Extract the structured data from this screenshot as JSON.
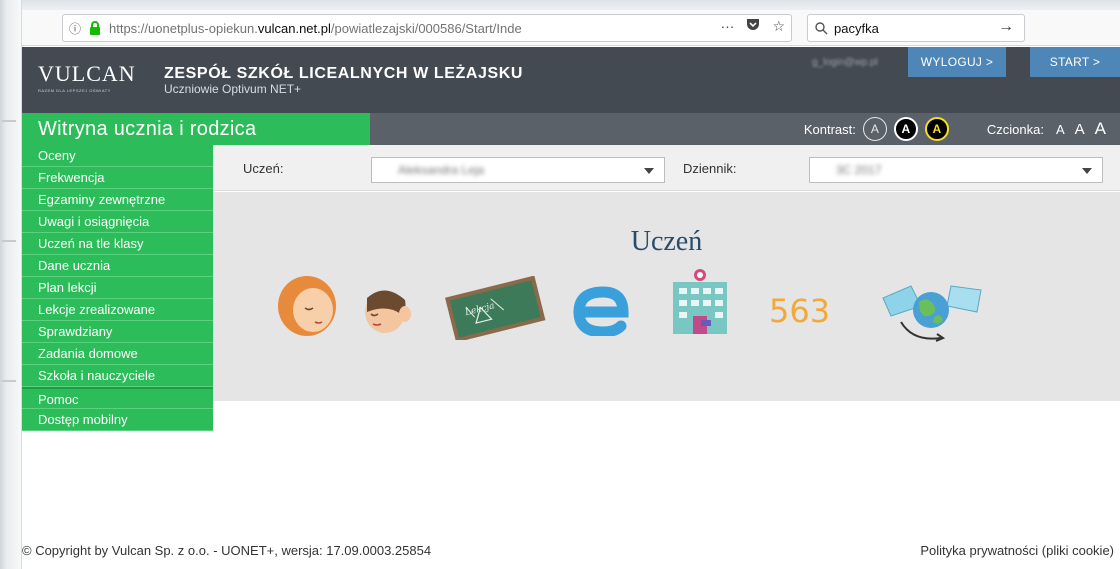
{
  "browser": {
    "url_prefix": "https://uonetplus-opiekun.",
    "url_domain": "vulcan.net.pl",
    "url_suffix": "/powiatlezajski/000586/Start/Inde",
    "more_icon": "···",
    "search_value": "pacyfka"
  },
  "header": {
    "logo_word": "VULCAN",
    "logo_tagline": "RAZEM DLA LEPSZEJ OŚWIATY",
    "school_name": "ZESPÓŁ SZKÓŁ LICEALNYCH W LEŻAJSKU",
    "school_subtitle": "Uczniowie Optivum NET+",
    "user_email": "g_login@wp.pl",
    "logout_label": "WYLOGUJ >",
    "start_label": "START >"
  },
  "band": {
    "title": "Witryna ucznia i rodzica",
    "contrast_label": "Kontrast:",
    "contrast_options": [
      "A",
      "A",
      "A"
    ],
    "font_label": "Czcionka:",
    "font_sizes": [
      "A",
      "A",
      "A"
    ]
  },
  "sidebar": {
    "items": [
      "Oceny",
      "Frekwencja",
      "Egzaminy zewnętrzne",
      "Uwagi i osiągnięcia",
      "Uczeń na tle klasy",
      "Dane ucznia",
      "Plan lekcji",
      "Lekcje zrealizowane",
      "Sprawdziany",
      "Zadania domowe",
      "Szkoła i nauczyciele",
      "Pomoc",
      "Dostęp mobilny"
    ]
  },
  "filters": {
    "student_label": "Uczeń:",
    "student_value": "Aleksandra Leja",
    "journal_label": "Dziennik:",
    "journal_value": "3C 2017"
  },
  "hero": {
    "title": "Uczeń",
    "icons": [
      "people-talking-icon",
      "chalkboard-icon",
      "e-letter-icon",
      "school-building-icon",
      "numbers-563-icon",
      "globe-mail-icon"
    ],
    "numbers_text": "563",
    "chalkboard_text": "Lekcja"
  },
  "footer": {
    "copyright": "© Copyright by Vulcan Sp. z o.o. - UONET+, wersja: 17.09.0003.25854",
    "privacy": "Polityka prywatności (pliki cookie)"
  },
  "colors": {
    "green": "#2cbd5a",
    "header_dark": "#444a52",
    "band_gray": "#5b6168",
    "blue_button": "#4f86b8"
  }
}
